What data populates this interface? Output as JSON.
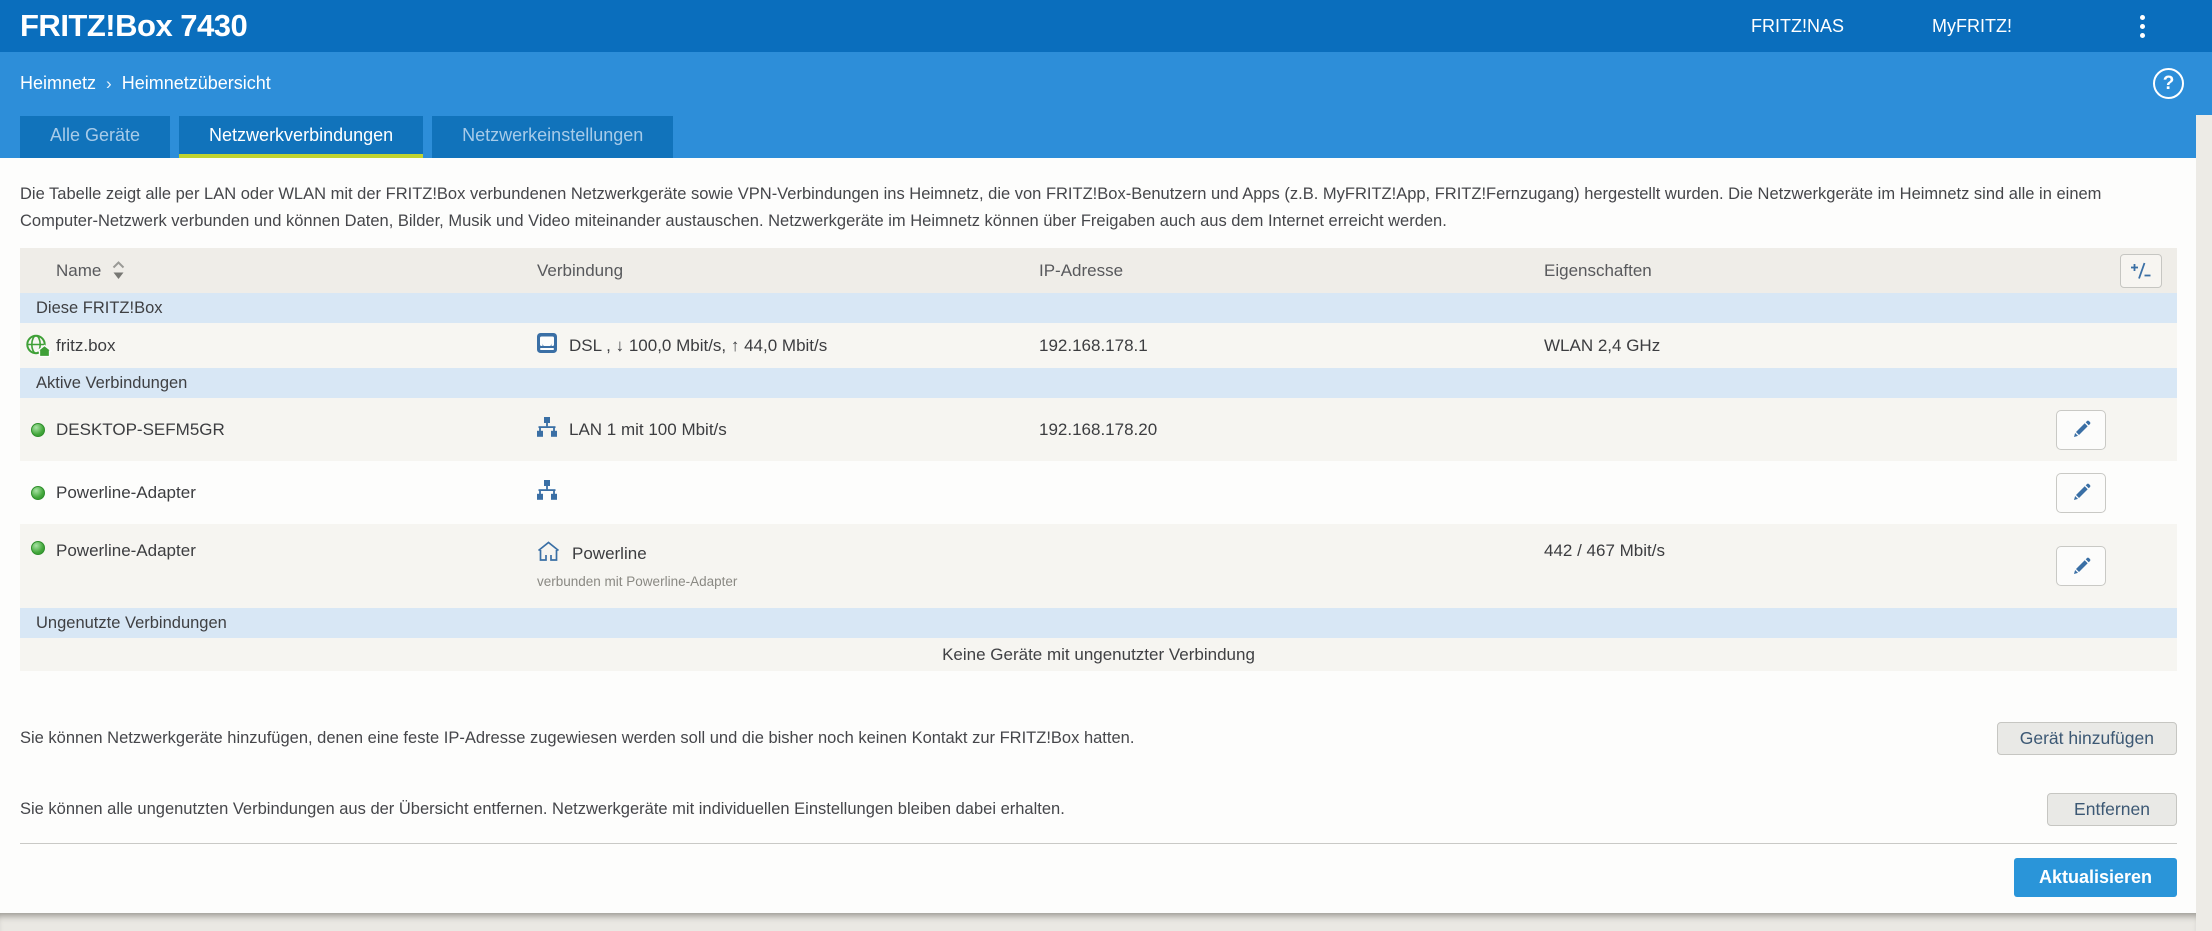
{
  "header": {
    "title": "FRITZ!Box 7430",
    "nav": [
      {
        "label": "FRITZ!NAS"
      },
      {
        "label": "MyFRITZ!"
      }
    ],
    "menu_icon": "kebab-vertical"
  },
  "breadcrumb": {
    "section": "Heimnetz",
    "separator": "›",
    "page": "Heimnetzübersicht"
  },
  "help_icon": {
    "glyph": "?"
  },
  "tabs": [
    {
      "label": "Alle Geräte",
      "active": false
    },
    {
      "label": "Netzwerkverbindungen",
      "active": true
    },
    {
      "label": "Netzwerkeinstellungen",
      "active": false
    }
  ],
  "intro": "Die Tabelle zeigt alle per LAN oder WLAN mit der FRITZ!Box verbundenen Netzwerkgeräte sowie VPN-Verbindungen ins Heimnetz, die von FRITZ!Box-Benutzern und Apps (z.B. MyFRITZ!App, FRITZ!Fernzugang) hergestellt wurden. Die Netzwerkgeräte im Heimnetz sind alle in einem Computer-Netzwerk verbunden und können Daten, Bilder, Musik und Video miteinander austauschen. Netzwerkgeräte im Heimnetz können über Freigaben auch aus dem Internet erreicht werden.",
  "table": {
    "columns": {
      "name": "Name",
      "connection": "Verbindung",
      "ip": "IP-Adresse",
      "properties": "Eigenschaften"
    },
    "sort_icon": "sort-asc-desc",
    "column_toggle_icon": "plus-minus",
    "sections": {
      "this_box": "Diese FRITZ!Box",
      "active": "Aktive Verbindungen",
      "unused": "Ungenutzte Verbindungen"
    },
    "rows": [
      {
        "icon": "globe-home-green",
        "name": "fritz.box",
        "conn_icon": "dsl-modem",
        "connection": "DSL , ↓ 100,0 Mbit/s, ↑ 44,0 Mbit/s",
        "ip": "192.168.178.1",
        "properties": "WLAN 2,4 GHz"
      },
      {
        "icon": "status-green",
        "name": "DESKTOP-SEFM5GR",
        "conn_icon": "lan",
        "connection": "LAN 1 mit 100 Mbit/s",
        "ip": "192.168.178.20",
        "properties": ""
      },
      {
        "icon": "status-green",
        "name": "Powerline-Adapter",
        "conn_icon": "lan",
        "connection": "",
        "ip": "",
        "properties": ""
      },
      {
        "icon": "status-green",
        "name": "Powerline-Adapter",
        "conn_icon": "powerline-house",
        "connection": "Powerline",
        "connection_sub": "verbunden mit Powerline-Adapter",
        "ip": "",
        "properties": "442 / 467 Mbit/s"
      }
    ],
    "empty_message": "Keine Geräte mit ungenutzter Verbindung",
    "edit_icon": "pencil"
  },
  "footer": {
    "add_text": "Sie können Netzwerkgeräte hinzufügen, denen eine feste IP-Adresse zugewiesen werden soll und die bisher noch keinen Kontakt zur FRITZ!Box hatten.",
    "add_button": "Gerät hinzufügen",
    "remove_text": "Sie können alle ungenutzten Verbindungen aus der Übersicht entfernen. Netzwerkgeräte mit individuellen Einstellungen bleiben dabei erhalten.",
    "remove_button": "Entfernen",
    "refresh_button": "Aktualisieren"
  },
  "colors": {
    "topbar": "#0a6ebd",
    "secondary_bar": "#2d8ed9",
    "tab_bg": "#1173bb",
    "tab_active_underline": "#c0d32f",
    "accent_blue": "#3a6fa5",
    "status_green": "#3fa037",
    "section_bg": "#d8e7f5",
    "refresh_button": "#2a95d9"
  }
}
